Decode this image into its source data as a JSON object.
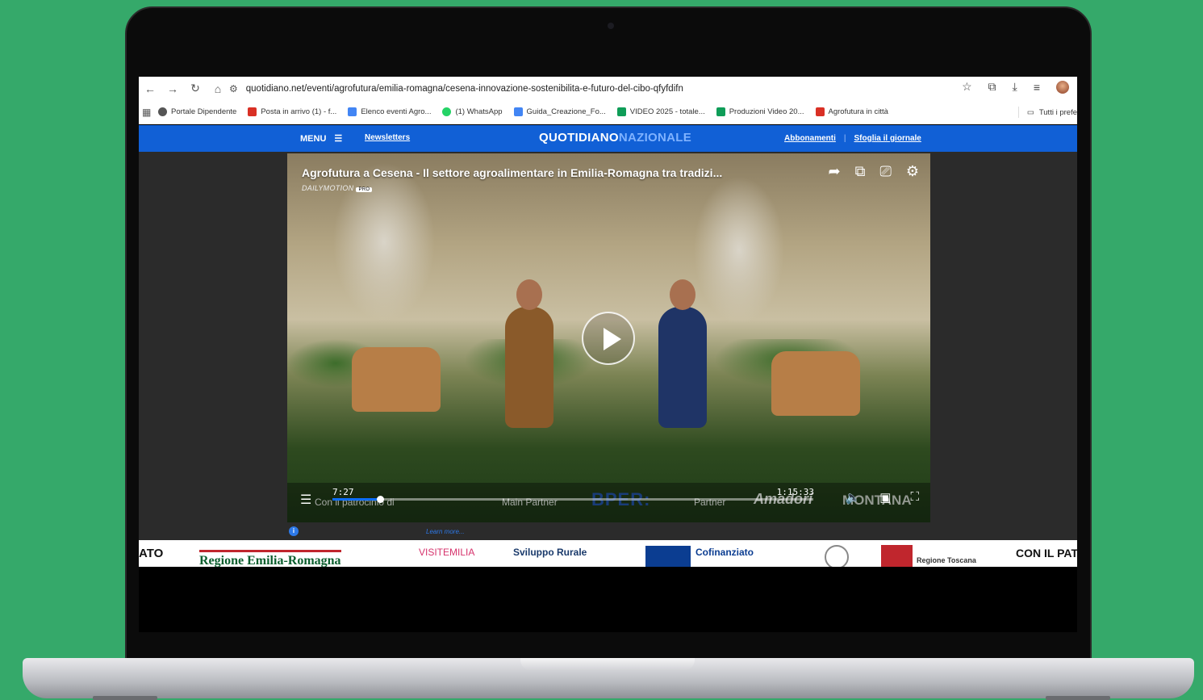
{
  "browser": {
    "url": "quotidiano.net/eventi/agrofutura/emilia-romagna/cesena-innovazione-sostenibilita-e-futuro-del-cibo-qfyfdifn",
    "bookmarks": [
      {
        "label": "Portale Dipendente",
        "color": "#555555"
      },
      {
        "label": "Posta in arrivo (1) - f...",
        "color": "#d93025"
      },
      {
        "label": "Elenco eventi Agro...",
        "color": "#4285f4"
      },
      {
        "label": "(1) WhatsApp",
        "color": "#25d366"
      },
      {
        "label": "Guida_Creazione_Fo...",
        "color": "#4285f4"
      },
      {
        "label": "VIDEO 2025 - totale...",
        "color": "#0f9d58"
      },
      {
        "label": "Produzioni Video 20...",
        "color": "#0f9d58"
      },
      {
        "label": "Agrofutura in città",
        "color": "#d93025"
      }
    ],
    "all_bookmarks": "Tutti i prefe"
  },
  "site": {
    "menu_label": "MENU",
    "newsletters": "Newsletters",
    "logo_bold": "QUOTIDIANO",
    "logo_light": "NAZIONALE",
    "subscriptions": "Abbonamenti",
    "newspaper": "Sfoglia il giornale"
  },
  "video": {
    "title": "Agrofutura a Cesena - Il settore agroalimentare in Emilia-Romagna tra tradizi...",
    "brand": "DAILYMOTION",
    "brand_badge": "PRO",
    "current_time": "7:27",
    "total_time": "1:15:33",
    "progress": 0.099,
    "sponsor_text_1": "Con il patrocinio di",
    "sponsor_text_2": "Main Partner",
    "sponsor_text_3": "Partner",
    "sponsor_bper": "BPER:",
    "sponsor_amadori": "Amadori",
    "sponsor_montana": "MONTANA",
    "learn_more": "Learn more..."
  },
  "footer_sponsors": [
    {
      "text": "ATO",
      "color": "#111111"
    },
    {
      "text": "Regione Emilia-Romagna",
      "color": "#0b5e2e"
    },
    {
      "text": "VISITEMILIA",
      "color": "#d6336c"
    },
    {
      "text": "Sviluppo Rurale",
      "color": "#1a3a6b"
    },
    {
      "text": "Cofinanziato",
      "color": "#0b3d91"
    },
    {
      "text": "Regione Toscana",
      "color": "#333333"
    },
    {
      "text": "CON IL PAT",
      "color": "#111111"
    }
  ]
}
